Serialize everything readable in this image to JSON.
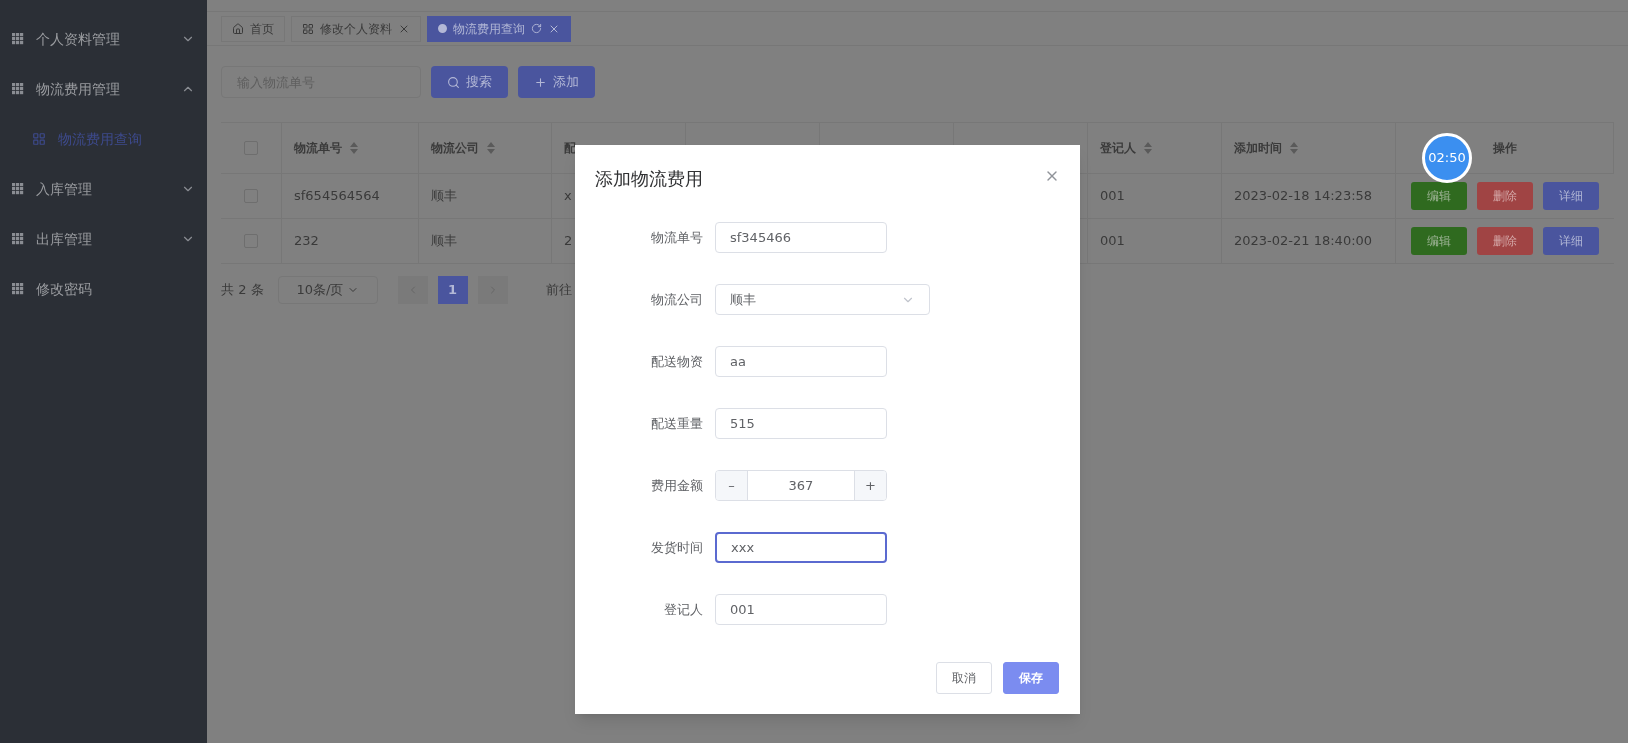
{
  "sidebar": {
    "items": [
      {
        "label": "个人资料管理",
        "expanded": false
      },
      {
        "label": "物流费用管理",
        "expanded": true,
        "children": [
          {
            "label": "物流费用查询",
            "selected": true
          }
        ]
      },
      {
        "label": "入库管理",
        "expanded": false
      },
      {
        "label": "出库管理",
        "expanded": false
      },
      {
        "label": "修改密码",
        "kind": "leaf"
      }
    ]
  },
  "tabs": [
    {
      "label": "首页",
      "kind": "home",
      "selected": false
    },
    {
      "label": "修改个人资料",
      "kind": "closable",
      "selected": false
    },
    {
      "label": "物流费用查询",
      "kind": "closable",
      "selected": true
    }
  ],
  "search": {
    "placeholder": "输入物流单号",
    "buttons": [
      "搜索",
      "添加"
    ]
  },
  "table": {
    "select_all_checked": false,
    "columns": [
      {
        "label": "物流单号",
        "sortable": true
      },
      {
        "label": "物流公司",
        "sortable": true
      },
      {
        "label": "配",
        "sortable": false
      },
      {
        "label": "登记人",
        "sortable": true
      },
      {
        "label": "添加时间",
        "sortable": true
      },
      {
        "label": "操作",
        "sortable": false
      }
    ],
    "rows": [
      {
        "checked": false,
        "cells": [
          "sf654564564",
          "顺丰",
          "x",
          "001",
          "2023-02-18 14:23:58"
        ],
        "actions": [
          "编辑",
          "删除",
          "详细"
        ]
      },
      {
        "checked": false,
        "cells": [
          "232",
          "顺丰",
          "2",
          "001",
          "2023-02-21 18:40:00"
        ],
        "actions": [
          "编辑",
          "删除",
          "详细"
        ]
      }
    ]
  },
  "pagination": {
    "total": "共 2 条",
    "page_size": "10条/页",
    "pages": [
      {
        "label": "1",
        "selected": true
      }
    ],
    "goto": "前往"
  },
  "timer": "02:50",
  "dialog": {
    "title": "添加物流费用",
    "fields": [
      {
        "label": "物流单号",
        "kind": "text",
        "value": "sf345466",
        "focused": false
      },
      {
        "label": "物流公司",
        "kind": "select",
        "value": "顺丰"
      },
      {
        "label": "配送物资",
        "kind": "text",
        "value": "aa",
        "focused": false
      },
      {
        "label": "配送重量",
        "kind": "text",
        "value": "515",
        "focused": false
      },
      {
        "label": "费用金额",
        "kind": "number",
        "value": "367",
        "minus": "–",
        "plus": "+"
      },
      {
        "label": "发货时间",
        "kind": "text",
        "value": "xxx",
        "focused": true
      },
      {
        "label": "登记人",
        "kind": "text",
        "value": "001",
        "focused": false
      }
    ],
    "buttons": [
      {
        "label": "取消",
        "kind": "default"
      },
      {
        "label": "保存",
        "kind": "primary"
      }
    ]
  }
}
